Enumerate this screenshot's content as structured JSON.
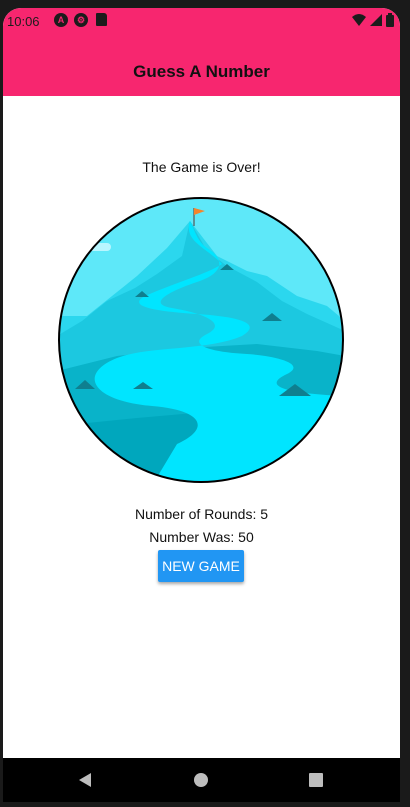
{
  "status_bar": {
    "time": "10:06",
    "icons": [
      "angular-icon",
      "settings-icon",
      "sd-card-icon",
      "wifi-icon",
      "signal-icon",
      "battery-icon"
    ]
  },
  "app_bar": {
    "title": "Guess A Number"
  },
  "game_over": {
    "title": "The Game is Over!",
    "image": "mountain-summit-illustration",
    "rounds_text": "Number of Rounds: 5",
    "number_text": "Number Was: 50",
    "new_game_label": "NEW GAME"
  },
  "nav_bar": {
    "buttons": [
      "back-icon",
      "home-icon",
      "recents-icon"
    ]
  },
  "colors": {
    "header": "#f7266f",
    "button": "#2196f3",
    "sky": "#5ee8f9",
    "river": "#00e5ff"
  }
}
